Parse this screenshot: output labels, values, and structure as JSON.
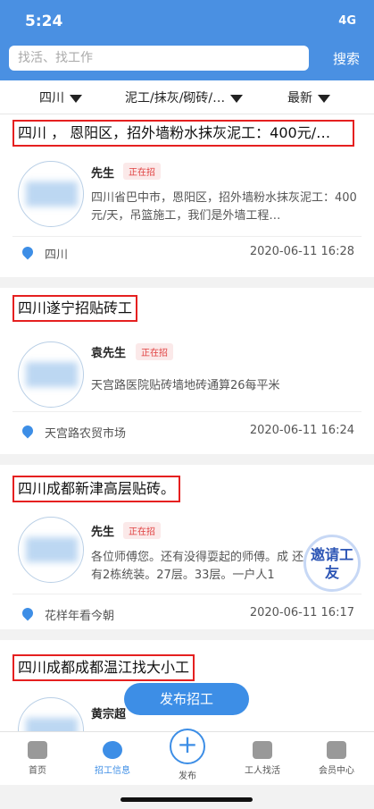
{
  "status": {
    "time": "5:24",
    "signal": "4G"
  },
  "search": {
    "placeholder": "找活、找工作",
    "button": "搜索"
  },
  "filters": [
    "四川",
    "泥工/抹灰/砌砖/…",
    "最新"
  ],
  "jobs": [
    {
      "title": "四川 ， 恩阳区，招外墙粉水抹灰泥工：400元/…",
      "contact": "先生",
      "badge": "正在招",
      "desc": "四川省巴中市，恩阳区，招外墙粉水抹灰泥工：400元/天，吊篮施工，我们是外墙工程…",
      "location": "四川",
      "date": "2020-06-11 16:28"
    },
    {
      "title": "四川遂宁招贴砖工",
      "contact": "袁先生",
      "badge": "正在招",
      "desc": "天宫路医院贴砖墙地砖通算26每平米",
      "location": "天宫路农贸市场",
      "date": "2020-06-11 16:24"
    },
    {
      "title": "四川成都新津高层贴砖。",
      "contact": "先生",
      "badge": "正在招",
      "desc": "各位师傅您。还有没得耍起的师傅。成 还有2栋统装。27层。33层。一户人1",
      "location": "花样年看今朝",
      "date": "2020-06-11 16:17"
    },
    {
      "title": "四川成都成都温江找大小工",
      "contact": "黄宗超",
      "badge": "",
      "desc": "",
      "location": "",
      "date": ""
    }
  ],
  "fab": "发布招工",
  "invite": "邀请工友",
  "tabs": [
    "首页",
    "招工信息",
    "发布",
    "工人找活",
    "会员中心"
  ]
}
